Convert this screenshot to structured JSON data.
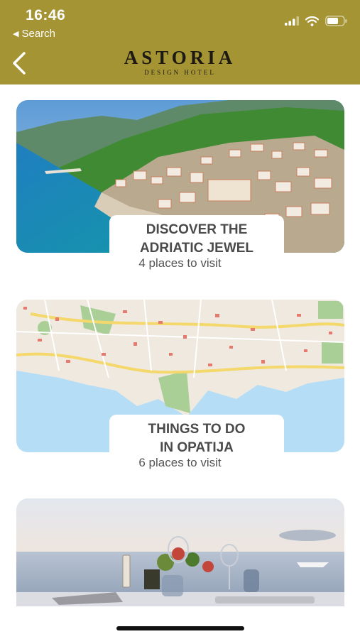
{
  "status_bar": {
    "time": "16:46",
    "back_label": "Search"
  },
  "header": {
    "brand_title": "ASTORIA",
    "brand_subtitle": "DESIGN HOTEL",
    "background_color": "#a59433"
  },
  "cards": [
    {
      "title_line1": "DISCOVER THE",
      "title_line2": "ADRIATIC JEWEL",
      "subtitle": "4 places to visit",
      "image": "aerial-coastal-town-photo"
    },
    {
      "title_line1": "THINGS TO DO",
      "title_line2": "IN OPATIJA",
      "subtitle": "6 places to visit",
      "image": "city-map"
    },
    {
      "image": "seaside-dinner-table-photo"
    }
  ]
}
